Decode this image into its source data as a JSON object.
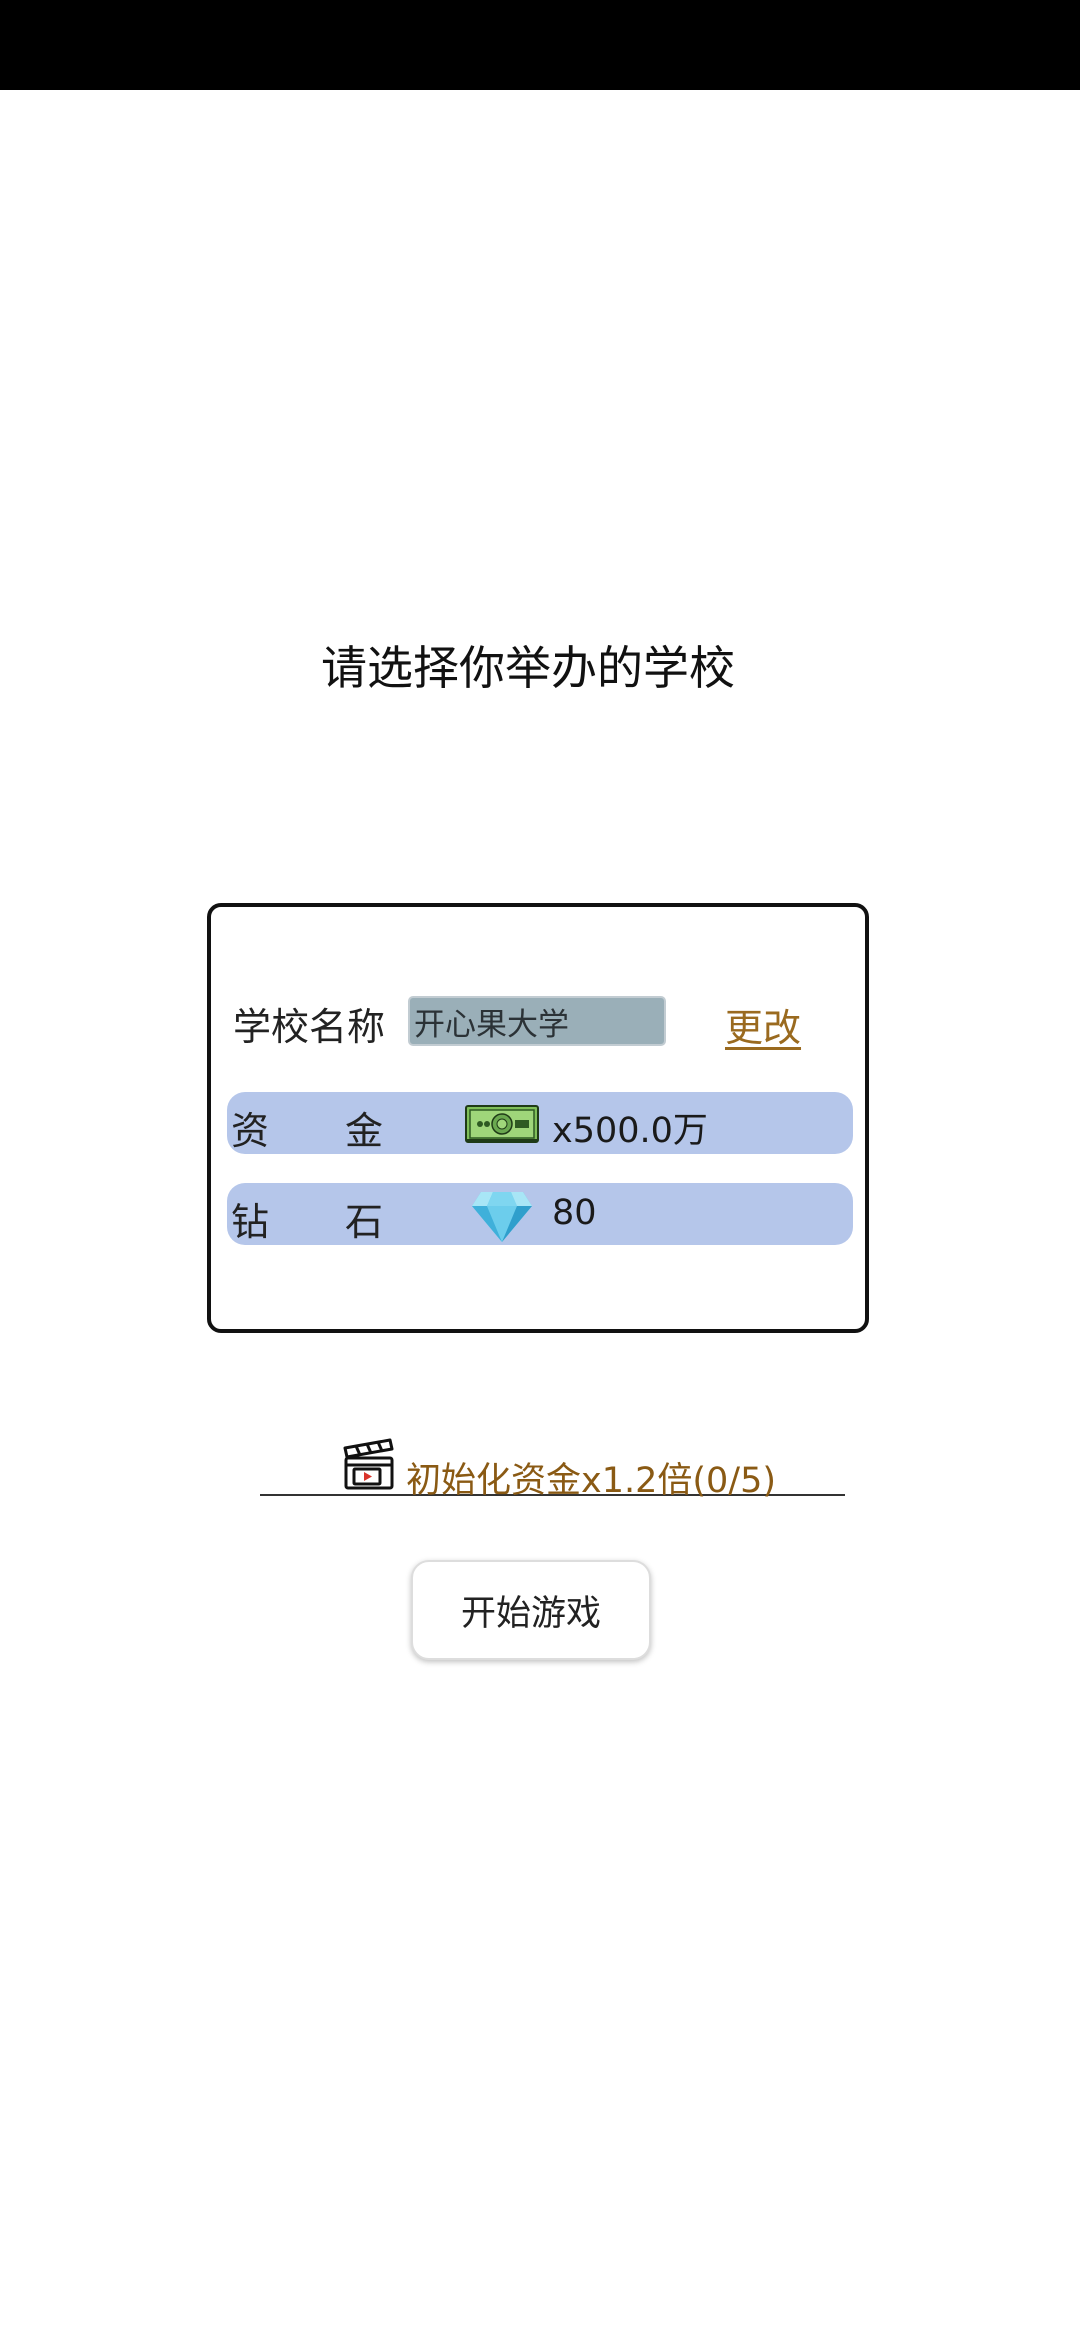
{
  "page": {
    "title": "请选择你举办的学校"
  },
  "school": {
    "name_label": "学校名称",
    "name_value": "开心果大学",
    "change_label": "更改"
  },
  "stats": {
    "funds": {
      "label_a": "资",
      "label_b": "金",
      "icon": "money-bill-icon",
      "value": "x500.0万"
    },
    "diamonds": {
      "label_a": "钻",
      "label_b": "石",
      "icon": "diamond-icon",
      "value": "80"
    }
  },
  "ad_bonus": {
    "icon": "clapperboard-video-icon",
    "text": "初始化资金x1.2倍(0/5)"
  },
  "start_button": {
    "label": "开始游戏"
  },
  "colors": {
    "panel_row_bg": "#b5c6ea",
    "input_bg": "#9aafb8",
    "link_color": "#9a6a1f",
    "ad_text_color": "#8a5a14"
  }
}
